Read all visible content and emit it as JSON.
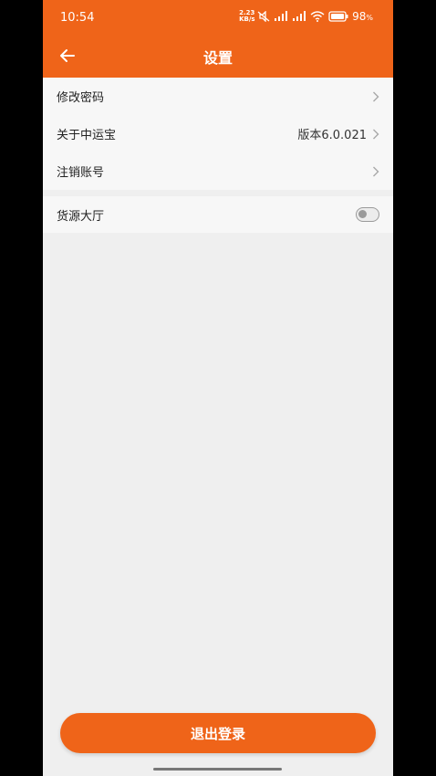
{
  "status_bar": {
    "time": "10:54",
    "net_speed_top": "2.23",
    "net_speed_bottom": "KB/s",
    "battery_percent": "98",
    "battery_unit": "%"
  },
  "header": {
    "title": "设置",
    "back_icon": "arrow-left-icon"
  },
  "settings": {
    "change_password": {
      "label": "修改密码"
    },
    "about": {
      "label": "关于中运宝",
      "value": "版本6.0.021"
    },
    "cancel_account": {
      "label": "注销账号"
    },
    "cargo_hall": {
      "label": "货源大厅",
      "enabled": false
    }
  },
  "footer": {
    "logout_label": "退出登录"
  },
  "colors": {
    "accent": "#ef6419",
    "background": "#efefef",
    "row_background": "#f7f7f7"
  }
}
